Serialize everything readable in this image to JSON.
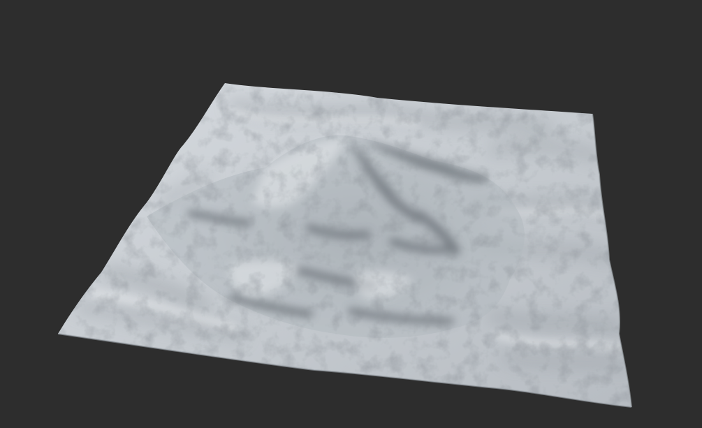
{
  "viewport": {
    "background_color": "#2d2d2d",
    "content": "terrain-render"
  },
  "terrain": {
    "material_color": "#c8cdd2",
    "shadow_color": "#3a3f45",
    "highlight_color": "#eef0f2"
  }
}
